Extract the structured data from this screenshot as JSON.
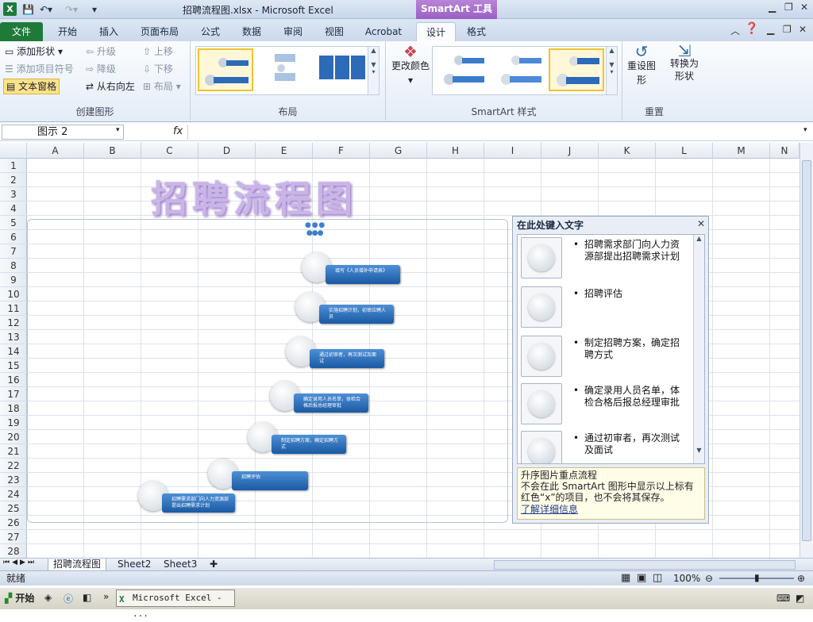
{
  "window": {
    "doc_title": "招聘流程图.xlsx  -  Microsoft Excel",
    "context_tool": "SmartArt 工具",
    "app_icon": "X"
  },
  "ribbon_tabs": [
    "文件",
    "开始",
    "插入",
    "页面布局",
    "公式",
    "数据",
    "审阅",
    "视图",
    "Acrobat",
    "设计",
    "格式"
  ],
  "active_tab": "设计",
  "groups": {
    "create": {
      "label": "创建图形",
      "add_shape": "添加形状",
      "add_bullet": "添加项目符号",
      "text_pane": "文本窗格",
      "promote": "升级",
      "demote": "降级",
      "rtl": "从右向左",
      "move_up": "上移",
      "move_down": "下移",
      "layout": "布局"
    },
    "layouts": {
      "label": "布局"
    },
    "styles": {
      "label": "SmartArt 样式",
      "change_colors": "更改颜色"
    },
    "reset": {
      "label": "重置",
      "reset_graphic": "重设图形",
      "convert": "转换为形状"
    }
  },
  "formula_bar": {
    "name_box": "图示 2",
    "fx": "fx",
    "value": ""
  },
  "columns": [
    "A",
    "B",
    "C",
    "D",
    "E",
    "F",
    "G",
    "H",
    "I",
    "J",
    "K",
    "L",
    "M",
    "N"
  ],
  "rows": [
    "1",
    "2",
    "3",
    "4",
    "5",
    "6",
    "7",
    "8",
    "9",
    "10",
    "11",
    "12",
    "13",
    "14",
    "15",
    "16",
    "17",
    "18",
    "19",
    "20",
    "21",
    "22",
    "23",
    "24",
    "25",
    "26",
    "27",
    "28"
  ],
  "art_title": "招聘流程图",
  "smartart_steps": [
    "填写《人员增补申请表》",
    "实施招聘计划，初审应聘人员",
    "通过初审者，再次测试及面试",
    "确定录用人员名单，体检合格后报总经理审批",
    "制定招聘方案，确定招聘方式",
    "招聘评估",
    "招聘需求部门向人力资源部提出招聘需求计划"
  ],
  "text_pane": {
    "title": "在此处键入文字",
    "items": [
      "招聘需求部门向人力资源部提出招聘需求计划",
      "招聘评估",
      "制定招聘方案，确定招聘方式",
      "确定录用人员名单，体检合格后报总经理审批",
      "通过初审者，再次测试及面试"
    ],
    "desc_title": "升序图片重点流程",
    "desc_body": "不会在此 SmartArt 图形中显示以上标有红色“x”的项目，也不会将其保存。",
    "link": "了解详细信息"
  },
  "sheets": [
    "招聘流程图",
    "Sheet2",
    "Sheet3"
  ],
  "status": {
    "ready": "就绪",
    "zoom": "100%"
  },
  "taskbar": {
    "start": "开始",
    "task": "Microsoft Excel - ..."
  }
}
